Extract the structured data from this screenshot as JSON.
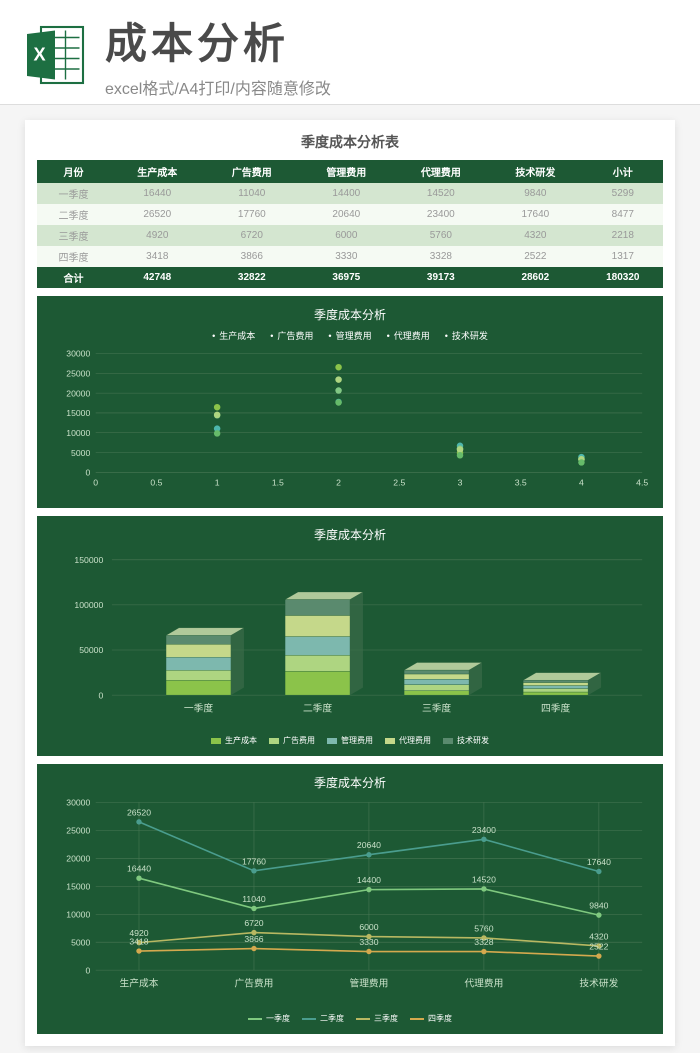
{
  "banner": {
    "title": "成本分析",
    "subtitle": "excel格式/A4打印/内容随意修改"
  },
  "sheet": {
    "title": "季度成本分析表",
    "headers": [
      "月份",
      "生产成本",
      "广告费用",
      "管理费用",
      "代理费用",
      "技术研发",
      "小计"
    ],
    "rows": [
      [
        "一季度",
        "16440",
        "11040",
        "14400",
        "14520",
        "9840",
        "5299"
      ],
      [
        "二季度",
        "26520",
        "17760",
        "20640",
        "23400",
        "17640",
        "8477"
      ],
      [
        "三季度",
        "4920",
        "6720",
        "6000",
        "5760",
        "4320",
        "2218"
      ],
      [
        "四季度",
        "3418",
        "3866",
        "3330",
        "3328",
        "2522",
        "1317"
      ]
    ],
    "totals": [
      "合计",
      "42748",
      "32822",
      "36975",
      "39173",
      "28602",
      "180320"
    ]
  },
  "charts": {
    "dot": {
      "title": "季度成本分析"
    },
    "bar3d": {
      "title": "季度成本分析"
    },
    "line": {
      "title": "季度成本分析"
    }
  },
  "categories": [
    "生产成本",
    "广告费用",
    "管理费用",
    "代理费用",
    "技术研发"
  ],
  "quarters": [
    "一季度",
    "二季度",
    "三季度",
    "四季度"
  ],
  "colors": {
    "q1": "#7fc97f",
    "q2": "#4a9d8e",
    "q3": "#b8b862",
    "q4": "#d4a94e",
    "s1": "#8bc34a",
    "s2": "#4db6ac",
    "s3": "#81c784",
    "s4": "#aed581",
    "s5": "#66bb6a"
  },
  "chart_data": [
    {
      "type": "scatter",
      "title": "季度成本分析",
      "xlabel": "",
      "ylabel": "",
      "xlim": [
        0,
        4.5
      ],
      "ylim": [
        0,
        30000
      ],
      "x_ticks": [
        0,
        0.5,
        1,
        1.5,
        2,
        2.5,
        3,
        3.5,
        4,
        4.5
      ],
      "y_ticks": [
        0,
        5000,
        10000,
        15000,
        20000,
        25000,
        30000
      ],
      "legend": [
        "生产成本",
        "广告费用",
        "管理费用",
        "代理费用",
        "技术研发"
      ],
      "x": [
        1,
        2,
        3,
        4
      ],
      "series": [
        {
          "name": "生产成本",
          "values": [
            16440,
            26520,
            4920,
            3418
          ]
        },
        {
          "name": "广告费用",
          "values": [
            11040,
            17760,
            6720,
            3866
          ]
        },
        {
          "name": "管理费用",
          "values": [
            14400,
            20640,
            6000,
            3330
          ]
        },
        {
          "name": "代理费用",
          "values": [
            14520,
            23400,
            5760,
            3328
          ]
        },
        {
          "name": "技术研发",
          "values": [
            9840,
            17640,
            4320,
            2522
          ]
        }
      ]
    },
    {
      "type": "bar",
      "title": "季度成本分析",
      "subtype": "stacked-3d",
      "categories": [
        "一季度",
        "二季度",
        "三季度",
        "四季度"
      ],
      "legend": [
        "生产成本",
        "广告费用",
        "管理费用",
        "代理费用",
        "技术研发"
      ],
      "ylabel": "",
      "ylim": [
        0,
        150000
      ],
      "y_ticks": [
        0,
        50000,
        100000,
        150000
      ],
      "series": [
        {
          "name": "生产成本",
          "values": [
            16440,
            26520,
            4920,
            3418
          ]
        },
        {
          "name": "广告费用",
          "values": [
            11040,
            17760,
            6720,
            3866
          ]
        },
        {
          "name": "管理费用",
          "values": [
            14400,
            20640,
            6000,
            3330
          ]
        },
        {
          "name": "代理费用",
          "values": [
            14520,
            23400,
            5760,
            3328
          ]
        },
        {
          "name": "技术研发",
          "values": [
            9840,
            17640,
            4320,
            2522
          ]
        }
      ],
      "stack_totals": [
        66240,
        105960,
        27720,
        16464
      ]
    },
    {
      "type": "line",
      "title": "季度成本分析",
      "categories": [
        "生产成本",
        "广告费用",
        "管理费用",
        "代理费用",
        "技术研发"
      ],
      "legend": [
        "一季度",
        "二季度",
        "三季度",
        "四季度"
      ],
      "ylabel": "",
      "ylim": [
        0,
        30000
      ],
      "y_ticks": [
        0,
        5000,
        10000,
        15000,
        20000,
        25000,
        30000
      ],
      "series": [
        {
          "name": "一季度",
          "values": [
            16440,
            11040,
            14400,
            14520,
            9840
          ]
        },
        {
          "name": "二季度",
          "values": [
            26520,
            17760,
            20640,
            23400,
            17640
          ]
        },
        {
          "name": "三季度",
          "values": [
            4920,
            6720,
            6000,
            5760,
            4320
          ]
        },
        {
          "name": "四季度",
          "values": [
            3418,
            3866,
            3330,
            3328,
            2522
          ]
        }
      ]
    }
  ]
}
